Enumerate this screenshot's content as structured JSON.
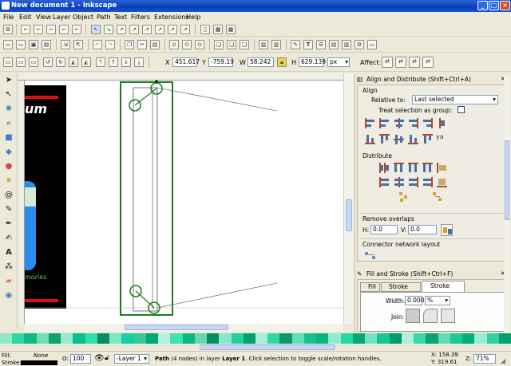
{
  "window": {
    "title": "New document 1 - Inkscape"
  },
  "menu": [
    "File",
    "Edit",
    "View",
    "Layer",
    "Object",
    "Path",
    "Text",
    "Filters",
    "Extensions",
    "Help"
  ],
  "toolbar": {
    "x_label": "X",
    "x_value": "451.617",
    "y_label": "Y",
    "y_value": "-759.19",
    "w_label": "W",
    "w_value": "58.242",
    "h_label": "H",
    "h_value": "629.139",
    "unit": "px",
    "affect_label": "Affect:"
  },
  "align_panel": {
    "title": "Align and Distribute (Shift+Ctrl+A)",
    "align_section": "Align",
    "relative_to_label": "Relative to:",
    "relative_to_value": "Last selected",
    "treat_group_label": "Treat selection as group:",
    "distribute_section": "Distribute",
    "remove_overlaps_section": "Remove overlaps",
    "h_label": "H:",
    "h_value": "0.0",
    "v_label": "V:",
    "v_value": "0.0",
    "connector_section": "Connector network layout"
  },
  "fill_stroke_panel": {
    "title": "Fill and Stroke (Shift+Ctrl+F)",
    "tabs": [
      "Fill",
      "Stroke paint",
      "Stroke style"
    ],
    "width_label": "Width:",
    "width_value": "0.000",
    "width_unit": "%",
    "join_label": "Join:"
  },
  "canvas": {
    "logo_fragment": "um",
    "logo_tagline": "mories"
  },
  "statusbar": {
    "fill_label": "Fill:",
    "fill_value": "None",
    "stroke_label": "Stroke:",
    "opacity_label": "O:",
    "opacity_value": "100",
    "layer_value": "-Layer 1",
    "message_bold": "Path",
    "message_rest": " (4 nodes) in layer ",
    "message_layer": "Layer 1",
    "message_end": ". Click selection to toggle scale/rotation handles.",
    "x_readout": "X:  158.39",
    "y_readout": "Y:  319.61",
    "zoom_label": "Z:",
    "zoom_value": "71%"
  },
  "colors": {
    "titlebar": "#0a3fb9",
    "selection_green": "#1f7a1f",
    "logo_black": "#000000",
    "logo_red": "#e01010",
    "logo_blue": "#2a8cf0",
    "tagline_green": "#5fcf4f"
  },
  "palette": [
    "#8ee8c8",
    "#2ad8a8",
    "#10b888",
    "#6ee0b8",
    "#0fa070",
    "#9ae8d0",
    "#05c090",
    "#2fe0b0",
    "#0a8a60",
    "#7fe8c0",
    "#15d0a0",
    "#3ac898",
    "#00a878",
    "#b8f0e0",
    "#40e0b0",
    "#0bb884",
    "#66d8b0",
    "#009060",
    "#88e8c8",
    "#20d0a0",
    "#06a070",
    "#a8f0d8",
    "#30d8a8",
    "#0c9868",
    "#5ee0b8",
    "#18c090",
    "#00b880",
    "#90ecd0",
    "#26d8a8",
    "#08a878",
    "#70e4c0",
    "#12c898",
    "#009a6c",
    "#b0f0dc",
    "#36dca8",
    "#0aa474",
    "#60dcb4",
    "#1cc894",
    "#00b07c",
    "#98ecd4",
    "#2ad4a4",
    "#04a072"
  ]
}
